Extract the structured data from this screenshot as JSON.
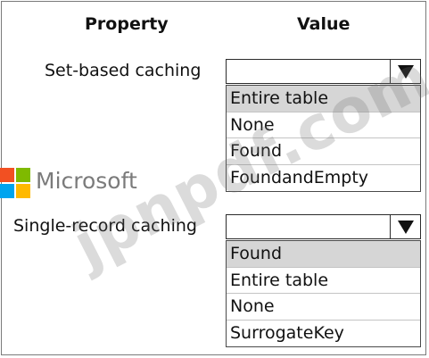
{
  "headers": {
    "property": "Property",
    "value": "Value"
  },
  "rows": [
    {
      "label": "Set-based caching",
      "selected_value": "",
      "options": [
        "Entire table",
        "None",
        "Found",
        "FoundandEmpty"
      ],
      "highlighted_option": "Entire table"
    },
    {
      "label": "Single-record caching",
      "selected_value": "",
      "options": [
        "Found",
        "Entire table",
        "None",
        "SurrogateKey"
      ],
      "highlighted_option": "Found"
    }
  ],
  "logo": {
    "text": "Microsoft",
    "colors": [
      "#f25022",
      "#7fba00",
      "#00a4ef",
      "#ffb900"
    ]
  },
  "watermark": "jpnpdf.com",
  "icons": {
    "dropdown": "triangle-down-icon",
    "logo": "microsoft-logo-icon"
  }
}
